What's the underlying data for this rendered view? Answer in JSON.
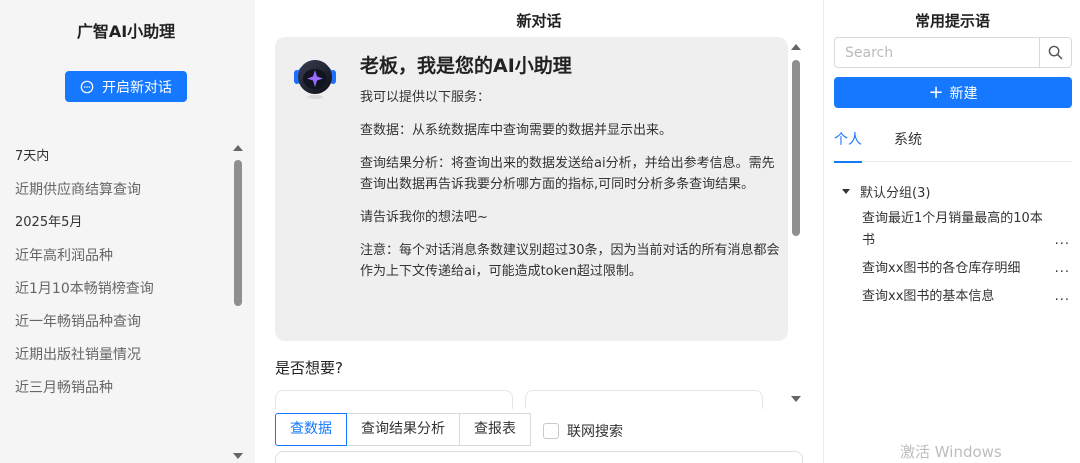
{
  "sidebar": {
    "app_title": "广智AI小助理",
    "new_chat_label": "开启新对话",
    "history": [
      {
        "type": "group",
        "label": "7天内"
      },
      {
        "type": "item",
        "label": "近期供应商结算查询"
      },
      {
        "type": "group",
        "label": "2025年5月"
      },
      {
        "type": "item",
        "label": "近年高利润品种"
      },
      {
        "type": "item",
        "label": "近1月10本畅销榜查询"
      },
      {
        "type": "item",
        "label": "近一年畅销品种查询"
      },
      {
        "type": "item",
        "label": "近期出版社销量情况"
      },
      {
        "type": "item",
        "label": "近三月畅销品种"
      }
    ]
  },
  "chat": {
    "title": "新对话",
    "greeting_title": "老板，我是您的AI小助理",
    "paragraphs": [
      "我可以提供以下服务：",
      "查数据：从系统数据库中查询需要的数据并显示出来。",
      "查询结果分析：将查询出来的数据发送给ai分析，并给出参考信息。需先查询出数据再告诉我要分析哪方面的指标,可同时分析多条查询结果。",
      "请告诉我你的想法吧~",
      "注意：每个对话消息条数建议别超过30条，因为当前对话的所有消息都会作为上下文传递给ai，可能造成token超过限制。"
    ],
    "want_prompt": "是否想要?",
    "tool_tabs": [
      "查数据",
      "查询结果分析",
      "查报表"
    ],
    "active_tool": "查数据",
    "web_search_label": "联网搜索",
    "web_search_checked": false
  },
  "prompts": {
    "title": "常用提示语",
    "search_placeholder": "Search",
    "new_button_label": "新建",
    "tabs": [
      "个人",
      "系统"
    ],
    "active_tab": "个人",
    "group_label": "默认分组(3)",
    "items": [
      "查询最近1个月销量最高的10本书",
      "查询xx图书的各仓库存明细",
      "查询xx图书的基本信息"
    ],
    "more_label": "..."
  },
  "os_watermark": "激活 Windows",
  "colors": {
    "accent": "#1677ff",
    "sidebar_bg": "#f5f5f5",
    "bubble_bg": "#efefef"
  }
}
